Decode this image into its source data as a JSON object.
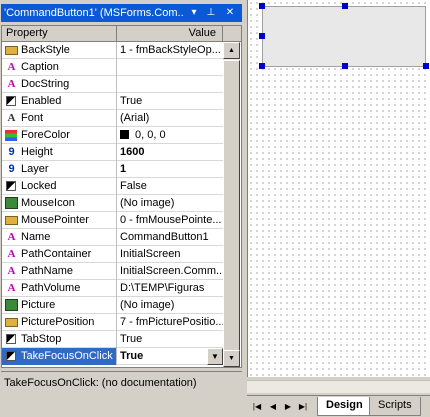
{
  "panel": {
    "title": "'CommandButton1' (MSForms.Com...",
    "header": {
      "property": "Property",
      "value": "Value"
    },
    "rows": [
      {
        "name": "BackStyle",
        "value": "1 - fmBackStyleOp...",
        "icon": "enum-icon"
      },
      {
        "name": "Caption",
        "value": "",
        "icon": "text-icon"
      },
      {
        "name": "DocString",
        "value": "",
        "icon": "text-icon"
      },
      {
        "name": "Enabled",
        "value": "True",
        "icon": "boolean-icon"
      },
      {
        "name": "Font",
        "value": "(Arial)",
        "icon": "font-icon"
      },
      {
        "name": "ForeColor",
        "value": "0, 0, 0",
        "icon": "color-icon"
      },
      {
        "name": "Height",
        "value": "1600",
        "icon": "number-icon",
        "bold": true
      },
      {
        "name": "Layer",
        "value": "1",
        "icon": "number-icon",
        "bold": true
      },
      {
        "name": "Locked",
        "value": "False",
        "icon": "boolean-icon"
      },
      {
        "name": "MouseIcon",
        "value": "(No image)",
        "icon": "picture-icon"
      },
      {
        "name": "MousePointer",
        "value": "0 - fmMousePointe...",
        "icon": "enum-icon"
      },
      {
        "name": "Name",
        "value": "CommandButton1",
        "icon": "text-icon"
      },
      {
        "name": "PathContainer",
        "value": "InitialScreen",
        "icon": "text-icon"
      },
      {
        "name": "PathName",
        "value": "InitialScreen.Comm...",
        "icon": "text-icon"
      },
      {
        "name": "PathVolume",
        "value": "D:\\TEMP\\Figuras",
        "icon": "text-icon"
      },
      {
        "name": "Picture",
        "value": "(No image)",
        "icon": "picture-icon"
      },
      {
        "name": "PicturePosition",
        "value": "7 - fmPicturePositio...",
        "icon": "enum-icon"
      },
      {
        "name": "TabStop",
        "value": "True",
        "icon": "boolean-icon"
      },
      {
        "name": "TakeFocusOnClick",
        "value": "True",
        "icon": "boolean-icon",
        "bold": true,
        "selected": true
      }
    ],
    "description": "TakeFocusOnClick: (no documentation)"
  },
  "designer": {
    "tabs": {
      "design": "Design",
      "scripts": "Scripts"
    }
  },
  "colors": {
    "titlebar": "#0a5ad6",
    "selection": "#316ac5",
    "handles": "#0000cc"
  }
}
